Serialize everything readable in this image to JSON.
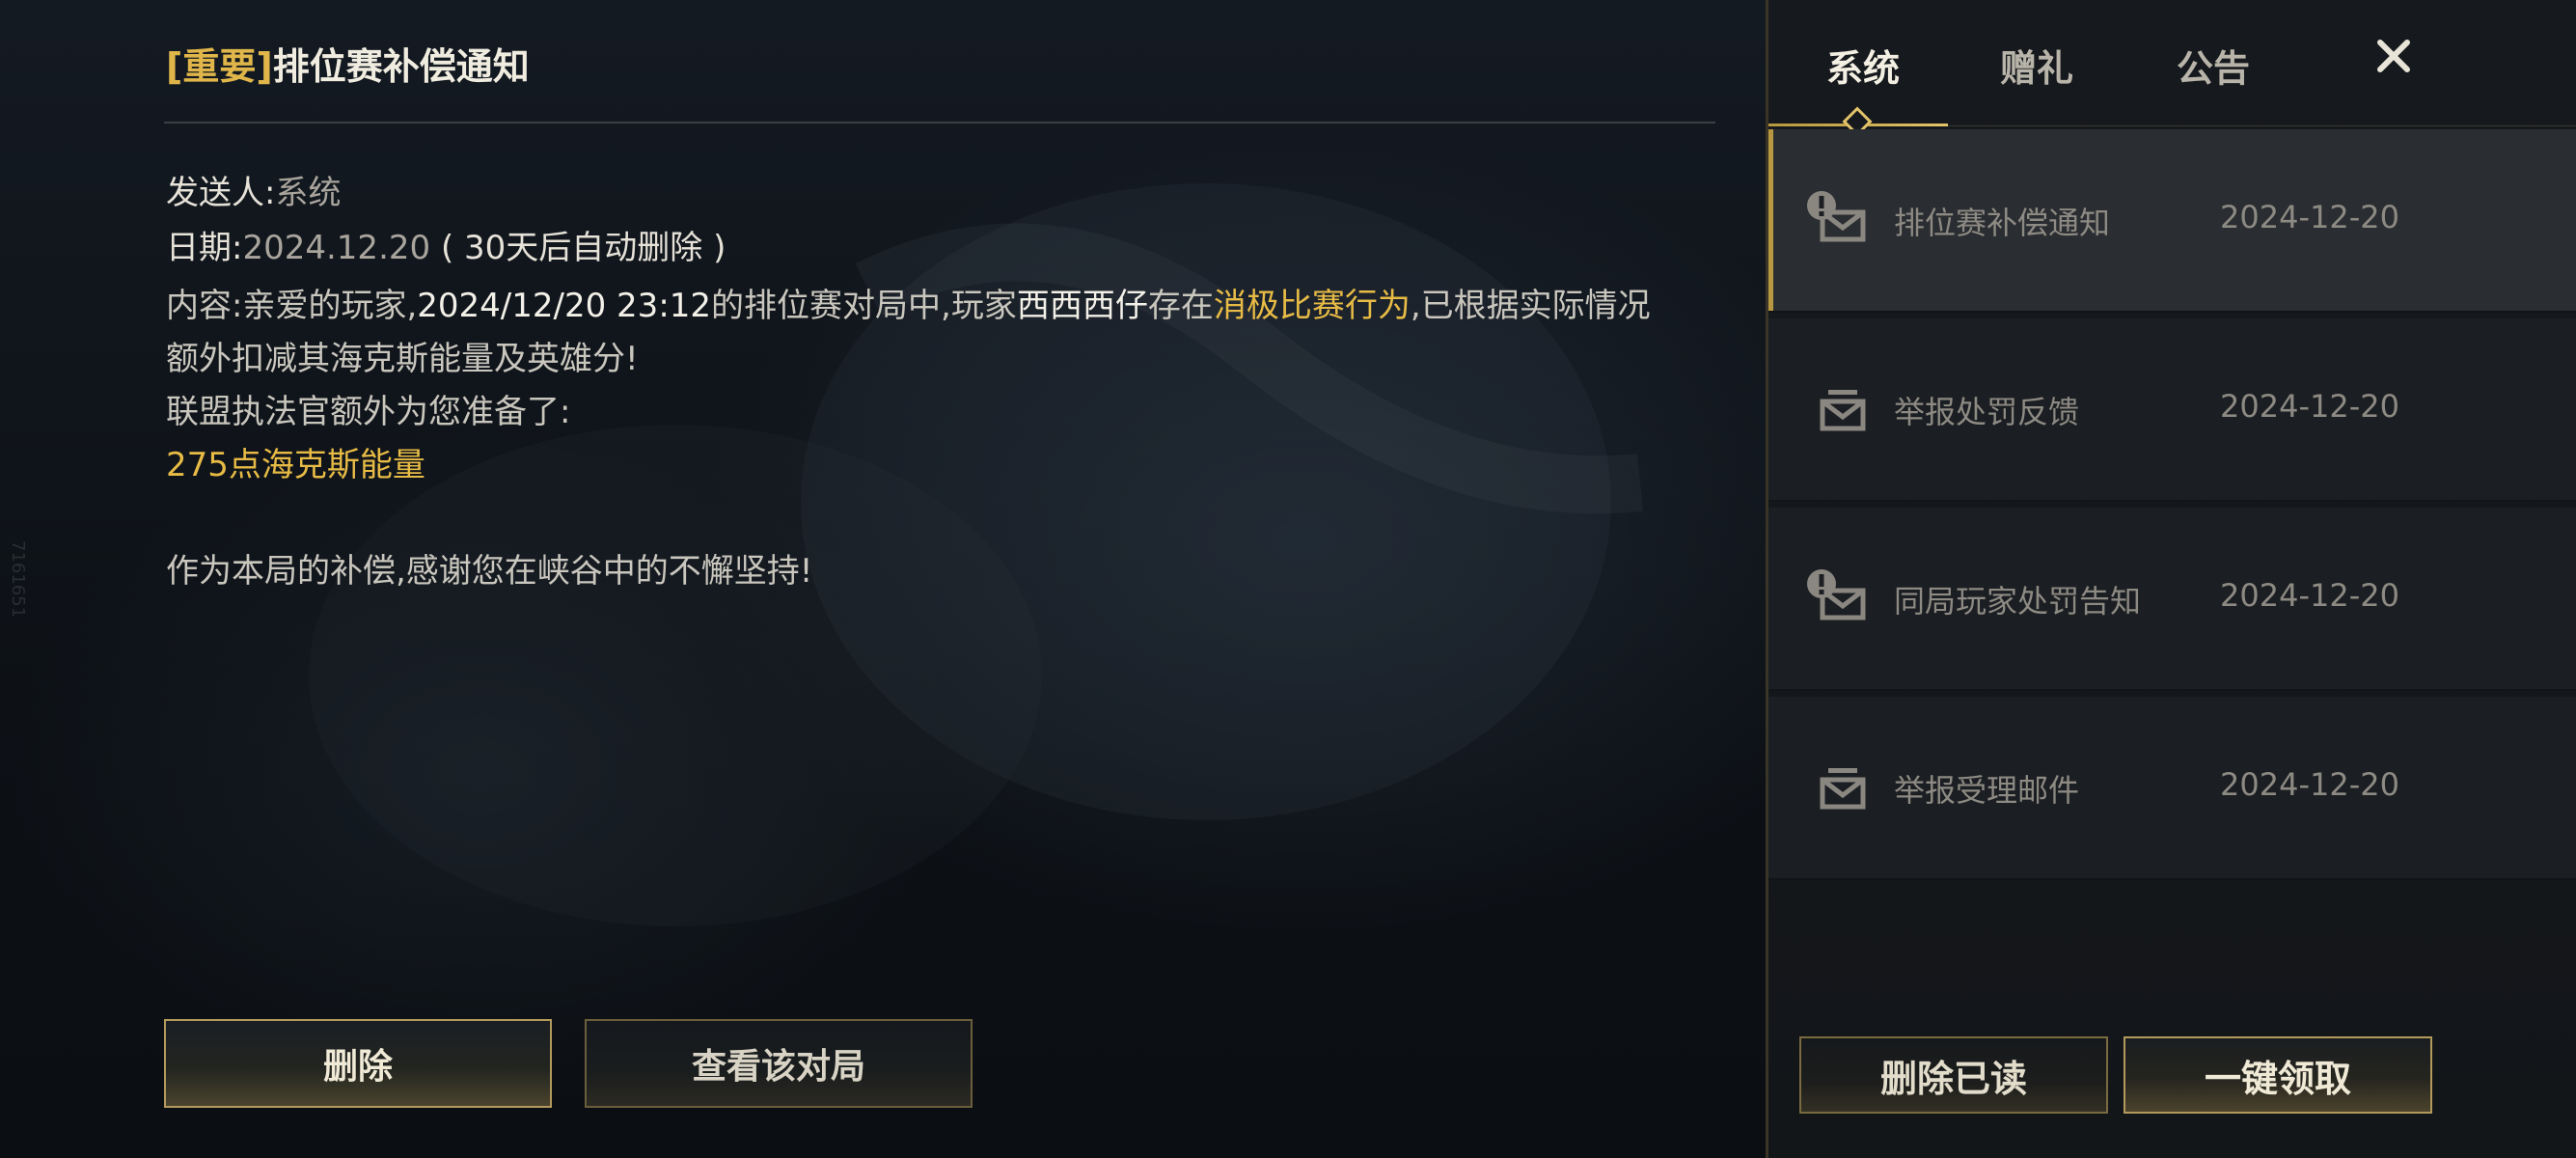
{
  "watermark": "7161651",
  "mail": {
    "title_tag": "[重要]",
    "title": "排位赛补偿通知",
    "sender_label": "发送人:",
    "sender": "系统",
    "date_label": "日期:",
    "date": "2024.12.20",
    "auto_delete": "( 30天后自动删除 )",
    "content_label": "内容:",
    "content_part1": "亲爱的玩家,",
    "content_datetime": "2024/12/20 23:12",
    "content_part2": "的排位赛对局中,玩家",
    "content_player": "西西西仔",
    "content_part3": "存在",
    "content_behavior": "消极比赛行为",
    "content_part4": ",已根据实际情况额外扣减其海克斯能量及英雄分!",
    "prepared_line": "联盟执法官额外为您准备了:",
    "reward": "275点海克斯能量",
    "closing": "作为本局的补偿,感谢您在峡谷中的不懈坚持!",
    "buttons": {
      "delete": "删除",
      "view_match": "查看该对局"
    }
  },
  "panel": {
    "tabs": [
      {
        "label": "系统",
        "active": true
      },
      {
        "label": "赠礼",
        "active": false
      },
      {
        "label": "公告",
        "active": false
      }
    ],
    "close_icon": "close-icon",
    "items": [
      {
        "title": "排位赛补偿通知",
        "date": "2024-12-20",
        "icon": "important-mail-icon",
        "selected": true
      },
      {
        "title": "举报处罚反馈",
        "date": "2024-12-20",
        "icon": "mail-icon",
        "selected": false
      },
      {
        "title": "同局玩家处罚告知",
        "date": "2024-12-20",
        "icon": "important-mail-icon",
        "selected": false
      },
      {
        "title": "举报受理邮件",
        "date": "2024-12-20",
        "icon": "mail-icon",
        "selected": false
      }
    ],
    "buttons": {
      "delete_read": "删除已读",
      "claim_all": "一键领取"
    }
  },
  "colors": {
    "gold": "#e7bb45",
    "accent_border": "#b39a5c"
  }
}
